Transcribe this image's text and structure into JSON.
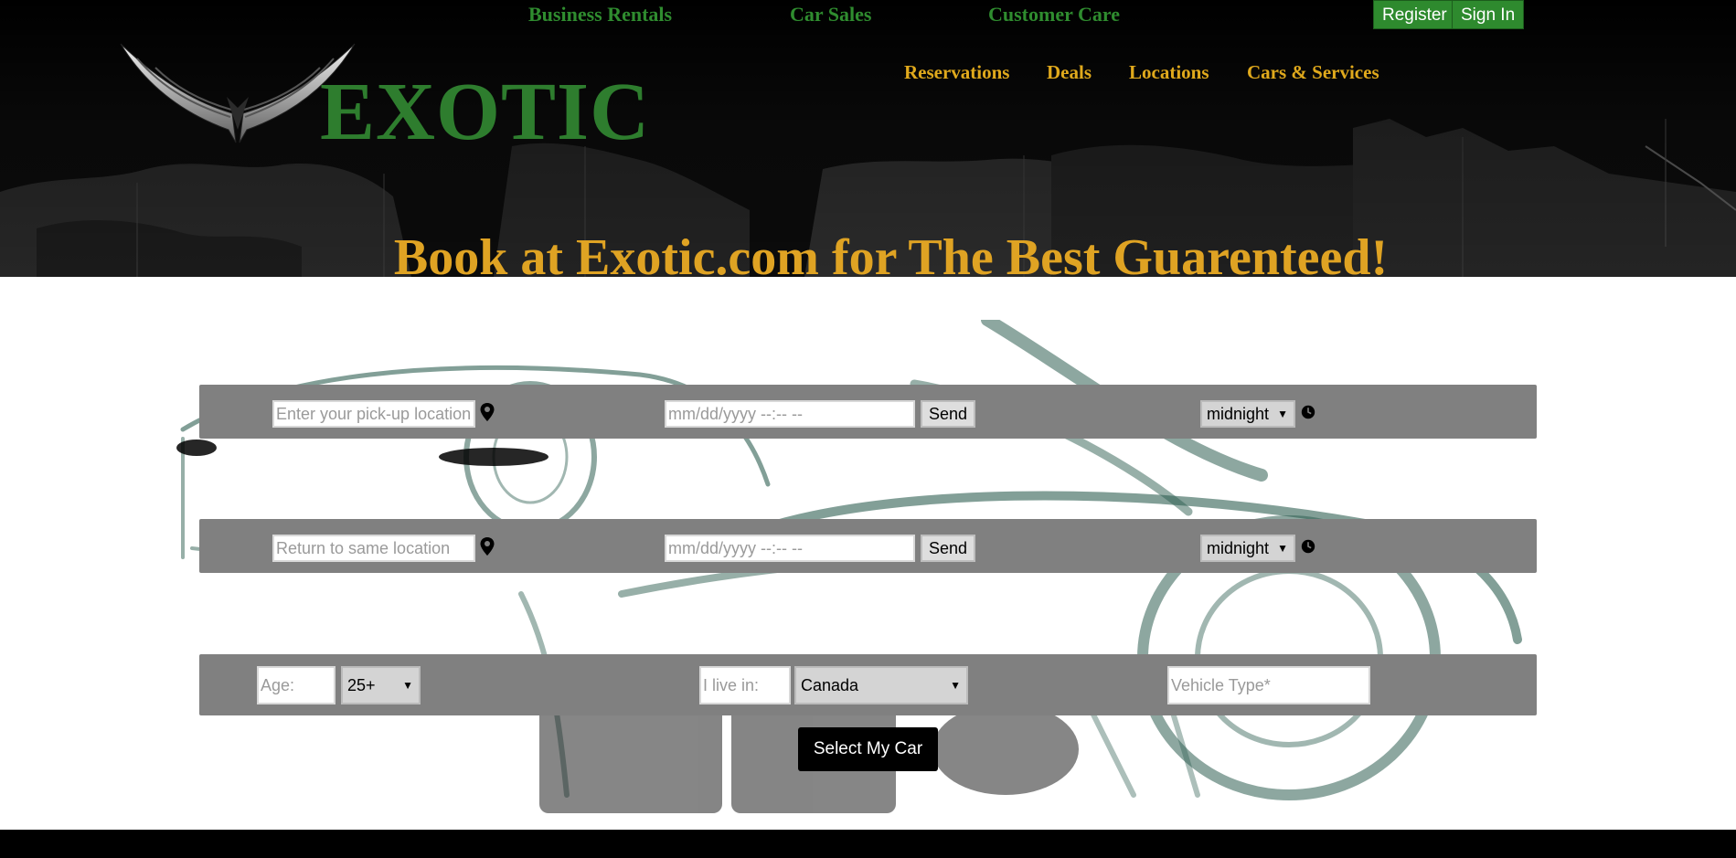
{
  "topnav": {
    "links": [
      "Business Rentals",
      "Car Sales",
      "Customer Care"
    ],
    "register": "Register",
    "signin": "Sign In"
  },
  "mainnav": {
    "links": [
      "Reservations",
      "Deals",
      "Locations",
      "Cars & Services"
    ]
  },
  "logo": {
    "text": "EXOTIC"
  },
  "slogan": "Book at Exotic.com for The Best Guarenteed!",
  "pickup": {
    "location_placeholder": "Enter your pick-up location",
    "datetime_placeholder": "mm/dd/yyyy --:-- --",
    "send": "Send",
    "time": "midnight"
  },
  "return": {
    "location_placeholder": "Return to same location",
    "datetime_placeholder": "mm/dd/yyyy --:-- --",
    "send": "Send",
    "time": "midnight"
  },
  "details": {
    "age_placeholder": "Age:",
    "age_value": "25+",
    "live_placeholder": "I live in:",
    "country": "Canada",
    "vehicle_placeholder": "Vehicle Type*"
  },
  "submit": "Select My Car",
  "colors": {
    "green": "#2e8a2e",
    "gold": "#dfa323",
    "bar": "#808080"
  }
}
